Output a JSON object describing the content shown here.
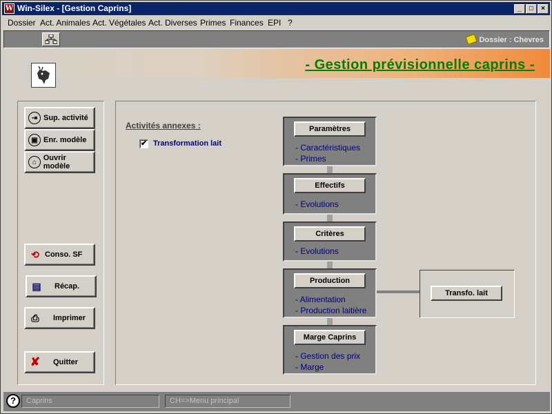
{
  "window": {
    "title": "Win-Silex - [Gestion Caprins]",
    "app_icon": "W",
    "controls": [
      "_",
      "□",
      "×"
    ]
  },
  "menu": [
    "Dossier",
    "Act. Animales",
    "Act. Végétales",
    "Act. Diverses",
    "Primes",
    "Finances",
    "EPI",
    "?"
  ],
  "toolbar": {
    "dossier_label": "Dossier : Chevres"
  },
  "banner": {
    "title": "- Gestion prévisionnelle caprins -"
  },
  "left_buttons": {
    "sup_activite": "Sup. activité",
    "enr_modele": "Enr. modèle",
    "ouvrir_modele": "Ouvrir modèle",
    "conso_sf": "Conso. SF",
    "recap": "Récap.",
    "imprimer": "Imprimer",
    "quitter": "Quitter"
  },
  "main": {
    "section_title": "Activités annexes :",
    "checkbox_label": "Transformation lait",
    "checkbox_checked": true,
    "steps": [
      {
        "button": "Paramètres",
        "items": [
          "- Caractéristiques",
          "- Primes"
        ]
      },
      {
        "button": "Effectifs",
        "items": [
          "- Evolutions"
        ]
      },
      {
        "button": "Critères",
        "items": [
          "- Evolutions"
        ]
      },
      {
        "button": "Production",
        "items": [
          "- Alimentation",
          "- Production laitière"
        ]
      },
      {
        "button": "Marge Caprins",
        "items": [
          "- Gestion des prix",
          "- Marge"
        ]
      }
    ],
    "transfo_button": "Transfo. lait"
  },
  "status": {
    "help": "?",
    "field1": "Caprins",
    "field2": "CH=>Menu principal"
  },
  "colors": {
    "title_bar": "#0a246a",
    "banner_title": "#008000",
    "link_text": "#000080"
  }
}
